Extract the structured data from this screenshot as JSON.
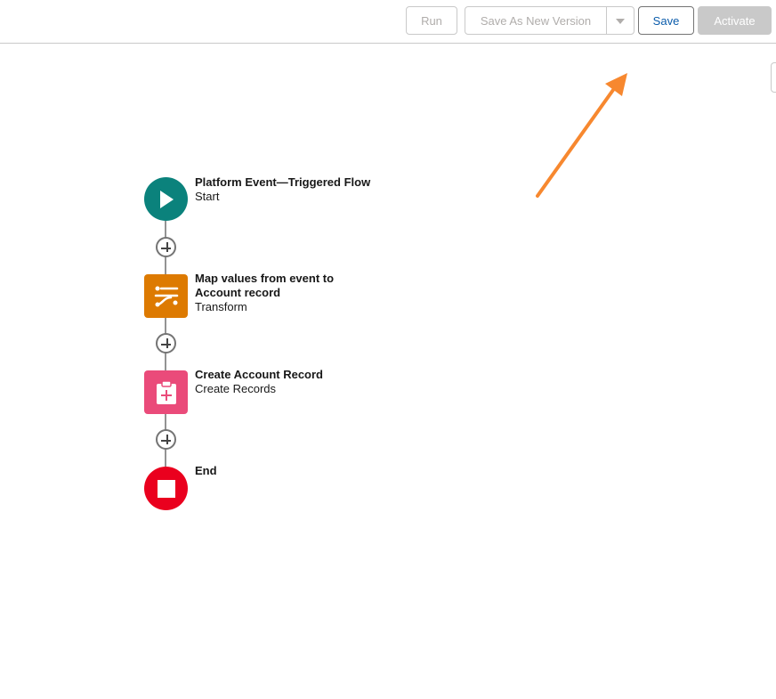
{
  "toolbar": {
    "run_label": "Run",
    "save_as_new_version_label": "Save As New Version",
    "save_label": "Save",
    "activate_label": "Activate"
  },
  "flow": {
    "nodes": [
      {
        "title": "Platform Event—Triggered Flow",
        "type": "Start",
        "icon": "play-icon"
      },
      {
        "title_line1": "Map values from event to",
        "title_line2": "Account record",
        "type": "Transform",
        "icon": "transform-icon"
      },
      {
        "title": "Create Account Record",
        "type": "Create Records",
        "icon": "create-records-icon"
      },
      {
        "title": "End",
        "icon": "stop-icon"
      }
    ],
    "add_element_icon": "plus-icon"
  },
  "colors": {
    "start": "#0b827c",
    "transform": "#dd7a01",
    "create_records": "#ea4b7a",
    "end": "#ea001e",
    "save_text": "#0b5cab",
    "annotation_arrow": "#f7882f"
  }
}
